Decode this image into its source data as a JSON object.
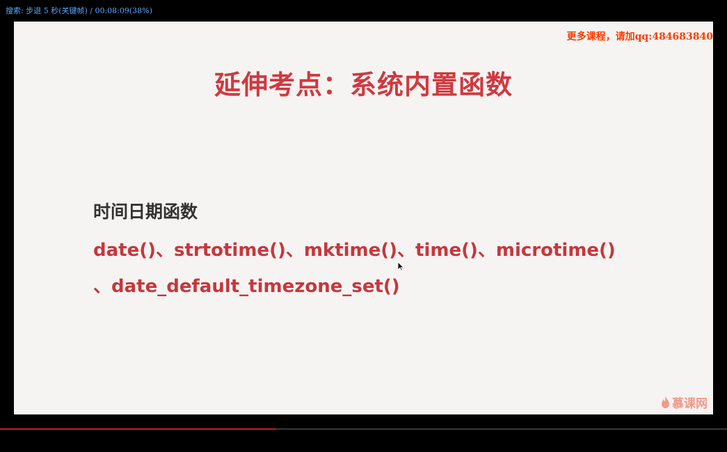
{
  "osd": {
    "text": "搜索: 步退 5 秒(关键帧) / 00:08:09(38%)"
  },
  "watermark": {
    "text": "更多课程，请加qq:484683840"
  },
  "slide": {
    "title": "延伸考点：系统内置函数",
    "subheading": "时间日期函数",
    "line1": "date()、strtotime()、mktime()、time()、microtime()",
    "line2": "、date_default_timezone_set()"
  },
  "logo": {
    "text": "慕课网",
    "icon": "flame-icon"
  },
  "player": {
    "progress": 0.38
  },
  "colors": {
    "title": "#d0393f",
    "body_red": "#c6373d",
    "osd": "#5aa7ff",
    "watermark": "#ff3c00",
    "progress": "#c41e1e"
  }
}
